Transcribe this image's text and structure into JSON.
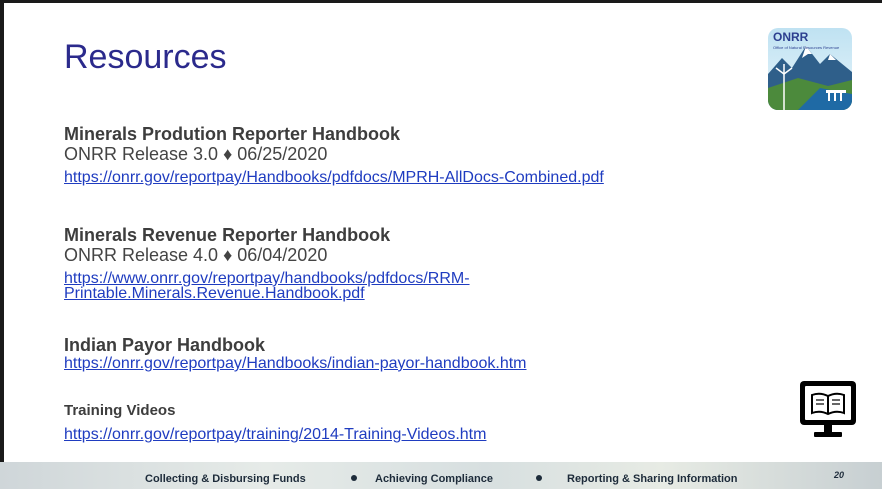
{
  "slide": {
    "title": "Resources",
    "logo_text": "ONRR",
    "logo_subtext": "Office of Natural Resources Revenue",
    "resources": [
      {
        "title": "Minerals Prodution Reporter Handbook",
        "meta": "ONRR Release 3.0 ♦ 06/25/2020",
        "link": "https://onrr.gov/reportpay/Handbooks/pdfdocs/MPRH-AllDocs-Combined.pdf"
      },
      {
        "title": "Minerals Revenue Reporter Handbook",
        "meta": "ONRR Release 4.0 ♦ 06/04/2020",
        "link_line1": "https://www.onrr.gov/reportpay/handbooks/pdfdocs/RRM-",
        "link_line2": "Printable.Minerals.Revenue.Handbook.pdf"
      },
      {
        "title": "Indian Payor Handbook",
        "link": "https://onrr.gov/reportpay/Handbooks/indian-payor-handbook.htm"
      },
      {
        "title": "Training Videos",
        "link": "https://onrr.gov/reportpay/training/2014-Training-Videos.htm"
      }
    ]
  },
  "footer": {
    "item1": "Collecting & Disbursing Funds",
    "item2": "Achieving Compliance",
    "item3": "Reporting & Sharing Information",
    "page_number": "20"
  },
  "icons": {
    "logo": "onrr-logo",
    "monitor": "monitor-book-icon"
  }
}
